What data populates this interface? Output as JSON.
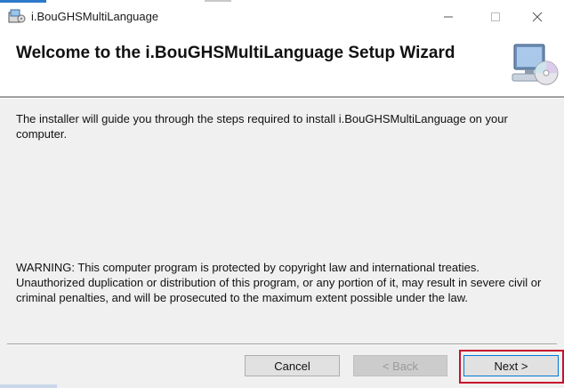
{
  "window": {
    "title": "i.BouGHSMultiLanguage",
    "controls": {
      "minimize": "—",
      "maximize": "☐",
      "close": "✕"
    }
  },
  "header": {
    "title": "Welcome to the i.BouGHSMultiLanguage Setup Wizard",
    "graphic_icon": "computer-cd-icon"
  },
  "body": {
    "intro": "The installer will guide you through the steps required to install i.BouGHSMultiLanguage on your computer.",
    "warning": "WARNING: This computer program is protected by copyright law and international treaties. Unauthorized duplication or distribution of this program, or any portion of it, may result in severe civil or criminal penalties, and will be prosecuted to the maximum extent possible under the law."
  },
  "buttons": {
    "cancel": "Cancel",
    "back": "< Back",
    "next": "Next >"
  },
  "colors": {
    "highlight": "#c8102e",
    "accent": "#0078d7"
  }
}
